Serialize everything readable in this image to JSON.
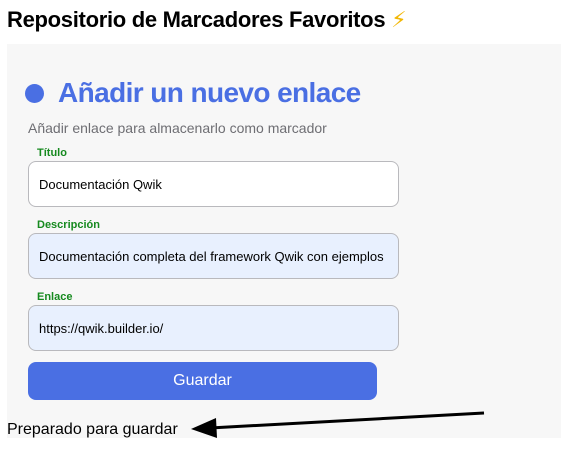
{
  "header": {
    "title": "Repositorio de Marcadores Favoritos",
    "icon": "lightning-bolt-icon",
    "icon_glyph": "⚡"
  },
  "form": {
    "title": "Añadir un nuevo enlace",
    "subtitle": "Añadir enlace para almacenarlo como marcador",
    "fields": {
      "title": {
        "label": "Título",
        "value": "Documentación Qwik"
      },
      "description": {
        "label": "Descripción",
        "value": "Documentación completa del framework Qwik con ejemplos"
      },
      "link": {
        "label": "Enlace",
        "value": "https://qwik.builder.io/"
      }
    },
    "save_label": "Guardar"
  },
  "status": {
    "text": "Preparado para guardar"
  },
  "colors": {
    "accent": "#4a6fe3",
    "label_green": "#168a1f",
    "autofill_bg": "#e8f0fe",
    "bolt": "#f2b705"
  }
}
